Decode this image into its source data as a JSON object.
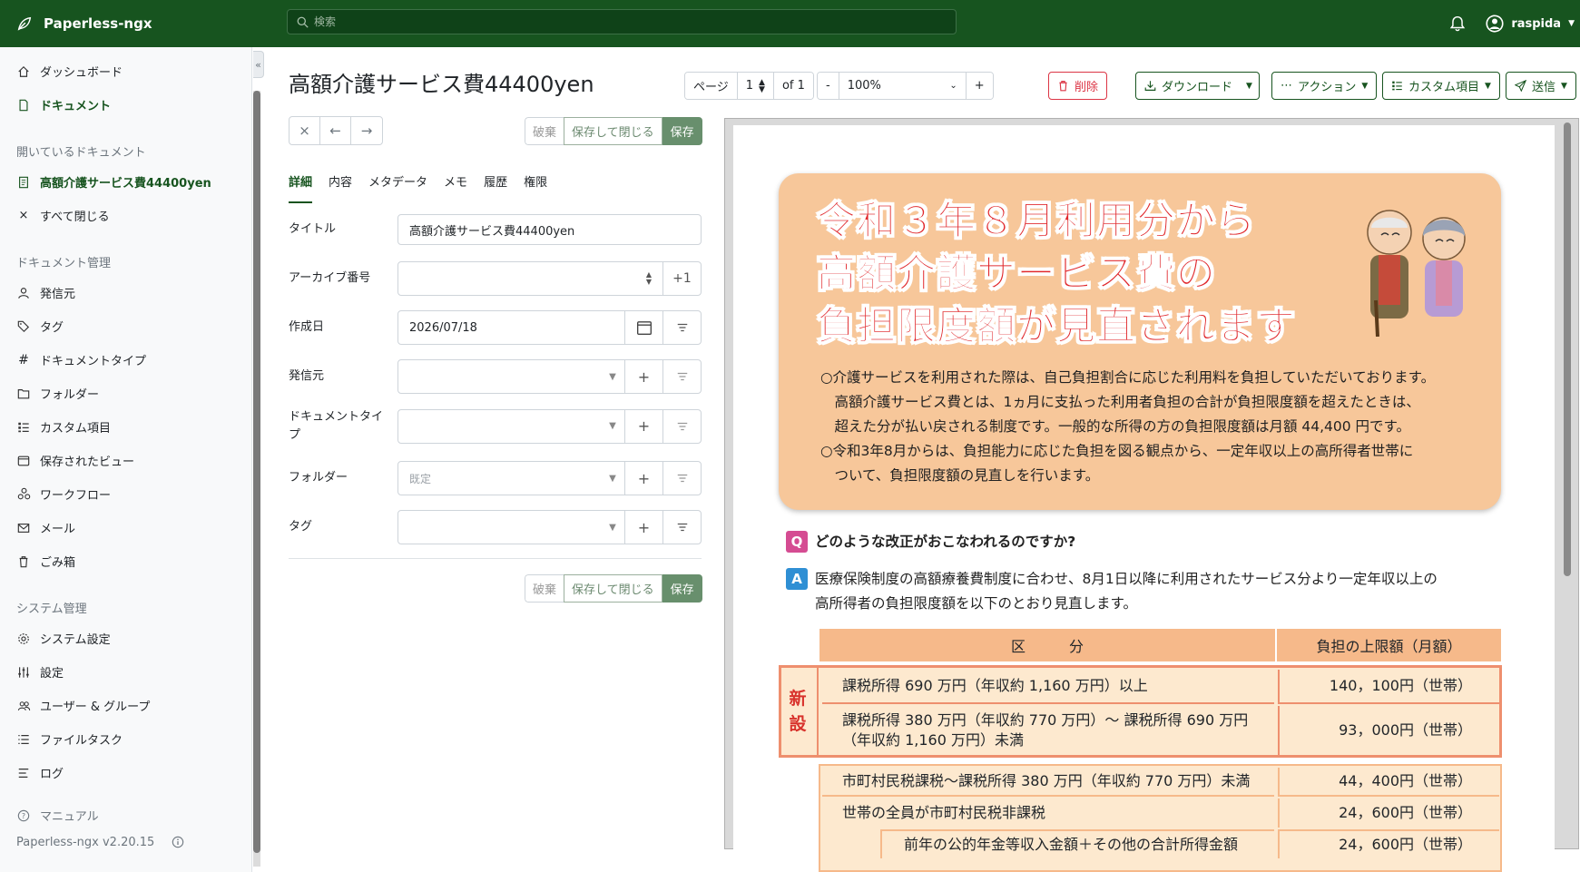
{
  "app": {
    "name": "Paperless-ngx",
    "search_placeholder": "検索",
    "user": "raspida"
  },
  "sidebar": {
    "main": [
      {
        "label": "ダッシュボード",
        "icon": "house-icon"
      },
      {
        "label": "ドキュメント",
        "icon": "file-icon"
      }
    ],
    "open_heading": "開いているドキュメント",
    "open_docs": [
      {
        "label": "高額介護サービス費44400yen",
        "icon": "file-text-icon"
      },
      {
        "label": "すべて閉じる",
        "icon": "x-icon"
      }
    ],
    "manage_heading": "ドキュメント管理",
    "manage": [
      {
        "label": "発信元",
        "icon": "person-icon"
      },
      {
        "label": "タグ",
        "icon": "tags-icon"
      },
      {
        "label": "ドキュメントタイプ",
        "icon": "hash-icon"
      },
      {
        "label": "フォルダー",
        "icon": "folder-icon"
      },
      {
        "label": "カスタム項目",
        "icon": "list-icon"
      },
      {
        "label": "保存されたビュー",
        "icon": "window-icon"
      },
      {
        "label": "ワークフロー",
        "icon": "workflow-icon"
      },
      {
        "label": "メール",
        "icon": "envelope-icon"
      },
      {
        "label": "ごみ箱",
        "icon": "trash-icon"
      }
    ],
    "system_heading": "システム管理",
    "system": [
      {
        "label": "システム設定",
        "icon": "gear-icon"
      },
      {
        "label": "設定",
        "icon": "sliders-icon"
      },
      {
        "label": "ユーザー & グループ",
        "icon": "people-icon"
      },
      {
        "label": "ファイルタスク",
        "icon": "list-task-icon"
      },
      {
        "label": "ログ",
        "icon": "log-icon"
      }
    ],
    "manual": "マニュアル",
    "version": "Paperless-ngx v2.20.15"
  },
  "document": {
    "title": "高額介護サービス費44400yen",
    "pager_label": "ページ",
    "page": "1",
    "page_of": "of 1",
    "zoom_minus": "-",
    "zoom": "100%",
    "zoom_plus": "+"
  },
  "actions": {
    "delete": "削除",
    "download": "ダウンロード",
    "actions": "アクション",
    "custom_fields": "カスタム項目",
    "send": "送信"
  },
  "save": {
    "discard": "破棄",
    "save_close": "保存して閉じる",
    "save": "保存"
  },
  "tabs": [
    "詳細",
    "内容",
    "メタデータ",
    "メモ",
    "履歴",
    "権限"
  ],
  "fields": {
    "title_label": "タイトル",
    "title_value": "高額介護サービス費44400yen",
    "asn_label": "アーカイブ番号",
    "asn_plus": "+1",
    "created_label": "作成日",
    "created_value": "2026/07/18",
    "correspondent_label": "発信元",
    "doctype_label": "ドキュメントタイプ",
    "folder_label": "フォルダー",
    "folder_placeholder": "既定",
    "tags_label": "タグ"
  },
  "preview": {
    "headline": [
      "令和３年８月利用分から",
      "高額介護サービス費の",
      "負担限度額が見直されます"
    ],
    "para": [
      "○介護サービスを利用された際は、自己負担割合に応じた利用料を負担していただいております。",
      "　高額介護サービス費とは、1ヵ月に支払った利用者負担の合計が負担限度額を超えたときは、",
      "　超えた分が払い戻される制度です。一般的な所得の方の負担限度額は月額 44,400 円です。",
      "○令和3年8月からは、負担能力に応じた負担を図る観点から、一定年収以上の高所得者世帯に",
      "　ついて、負担限度額の見直しを行います。"
    ],
    "q_badge": "Q",
    "question": "どのような改正がおこなわれるのですか?",
    "a_badge": "A",
    "answer": [
      "医療保険制度の高額療養費制度に合わせ、8月1日以降に利用されたサービス分より一定年収以上の",
      "高所得者の負担限度額を以下のとおり見直します。"
    ],
    "table_head": [
      "区　　　分",
      "負担の上限額（月額）"
    ],
    "new_mark": [
      "新",
      "設"
    ],
    "rows": [
      {
        "label": "課税所得 690 万円（年収約 1,160 万円）以上",
        "value": "140，100円（世帯）"
      },
      {
        "label": "課税所得 380 万円（年収約 770 万円）～ 課税所得 690 万円",
        "label2": "（年収約 1,160 万円）未満",
        "value": "93，000円（世帯）"
      },
      {
        "label": "市町村民税課税～課税所得 380 万円（年収約 770 万円）未満",
        "value": "44，400円（世帯）"
      },
      {
        "label": "世帯の全員が市町村民税非課税",
        "value": "24，600円（世帯）"
      },
      {
        "label": "前年の公的年金等収入金額＋その他の合計所得金額",
        "value": "24，600円（世帯）"
      }
    ]
  }
}
